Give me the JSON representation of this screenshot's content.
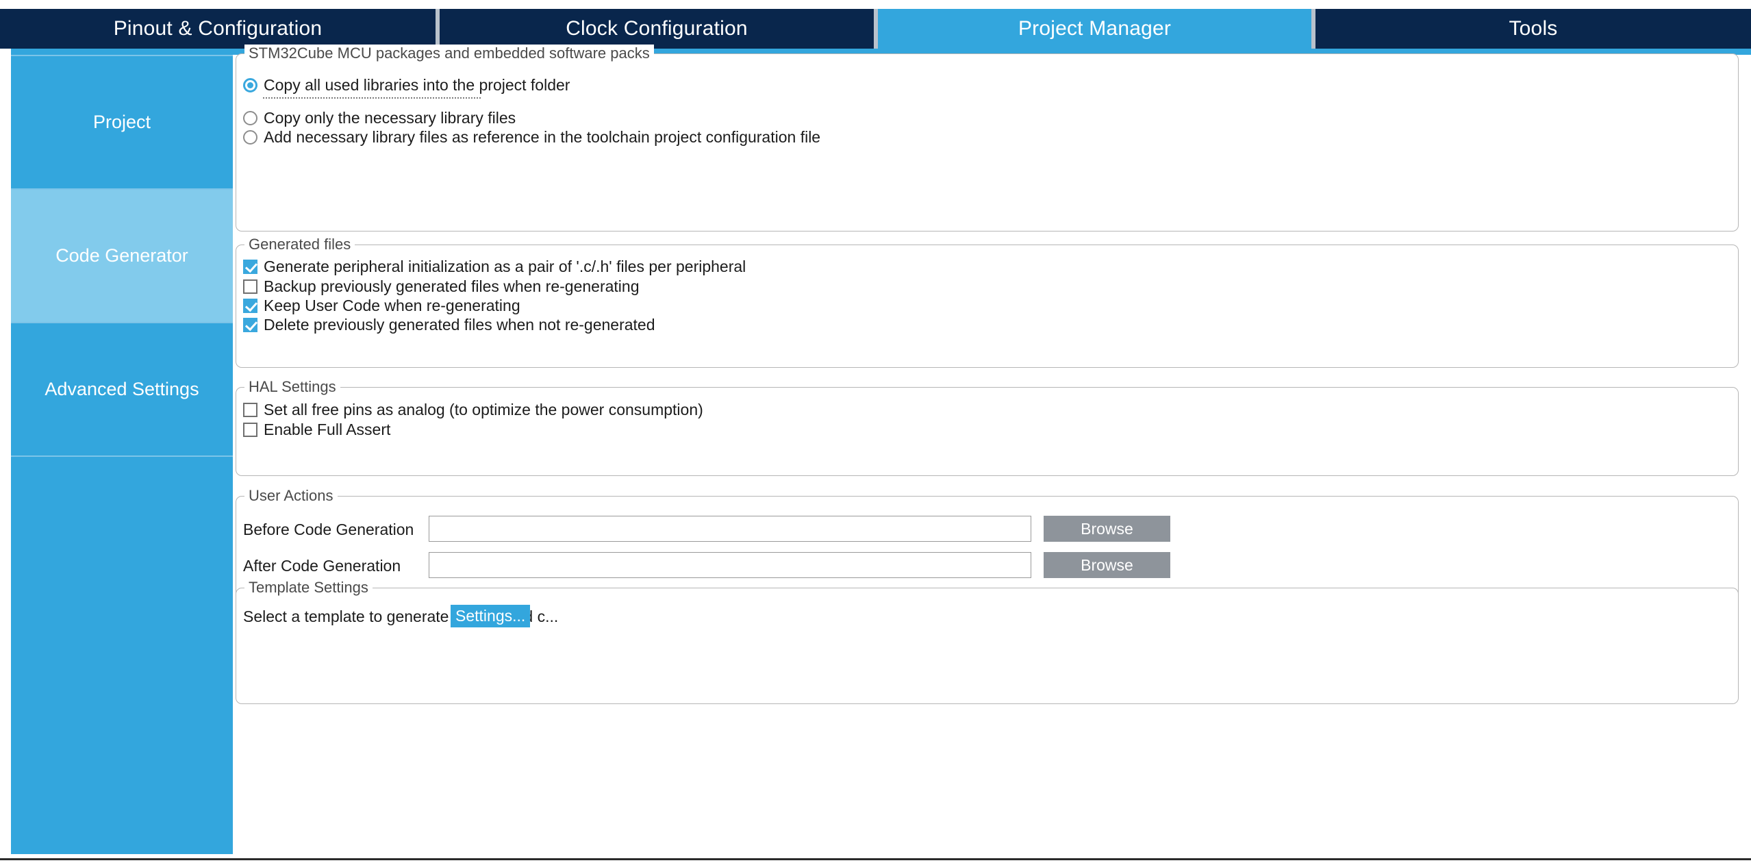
{
  "tabs": [
    {
      "label": "Pinout & Configuration",
      "active": false
    },
    {
      "label": "Clock Configuration",
      "active": false
    },
    {
      "label": "Project Manager",
      "active": true
    },
    {
      "label": "Tools",
      "active": false
    }
  ],
  "sidebar": {
    "items": [
      {
        "label": "Project",
        "active": false
      },
      {
        "label": "Code Generator",
        "active": true
      },
      {
        "label": "Advanced Settings",
        "active": false
      }
    ]
  },
  "groups": {
    "packages": {
      "title": "STM32Cube MCU packages and embedded software packs",
      "options": [
        {
          "label": "Copy all used libraries into the project folder",
          "selected": true
        },
        {
          "label": "Copy only the necessary library files",
          "selected": false
        },
        {
          "label": "Add necessary library files as reference in the toolchain project configuration file",
          "selected": false
        }
      ]
    },
    "generated_files": {
      "title": "Generated files",
      "options": [
        {
          "label": "Generate peripheral initialization as a pair of '.c/.h' files per peripheral",
          "checked": true
        },
        {
          "label": "Backup previously generated files when re-generating",
          "checked": false
        },
        {
          "label": "Keep User Code when re-generating",
          "checked": true
        },
        {
          "label": "Delete previously generated files when not re-generated",
          "checked": true
        }
      ]
    },
    "hal_settings": {
      "title": "HAL Settings",
      "options": [
        {
          "label": "Set all free pins as analog (to optimize the power consumption)",
          "checked": false
        },
        {
          "label": "Enable Full Assert",
          "checked": false
        }
      ]
    },
    "user_actions": {
      "title": "User Actions",
      "rows": [
        {
          "label": "Before Code Generation",
          "value": "",
          "placeholder": "",
          "button": "Browse"
        },
        {
          "label": "After Code Generation",
          "value": "",
          "placeholder": "",
          "button": "Browse"
        }
      ]
    },
    "template_settings": {
      "title": "Template Settings",
      "description": "Select a template to generate customized c...",
      "button": "Settings..."
    }
  },
  "colors": {
    "tab_inactive_bg": "#09264c",
    "tab_active_bg": "#33a6dd",
    "sidebar_bg": "#33a6dd",
    "sidebar_active_bg": "#82cbec",
    "accent": "#3aa8de",
    "browse_button_bg": "#8e949b",
    "groupbox_border": "#b6b6b6"
  }
}
